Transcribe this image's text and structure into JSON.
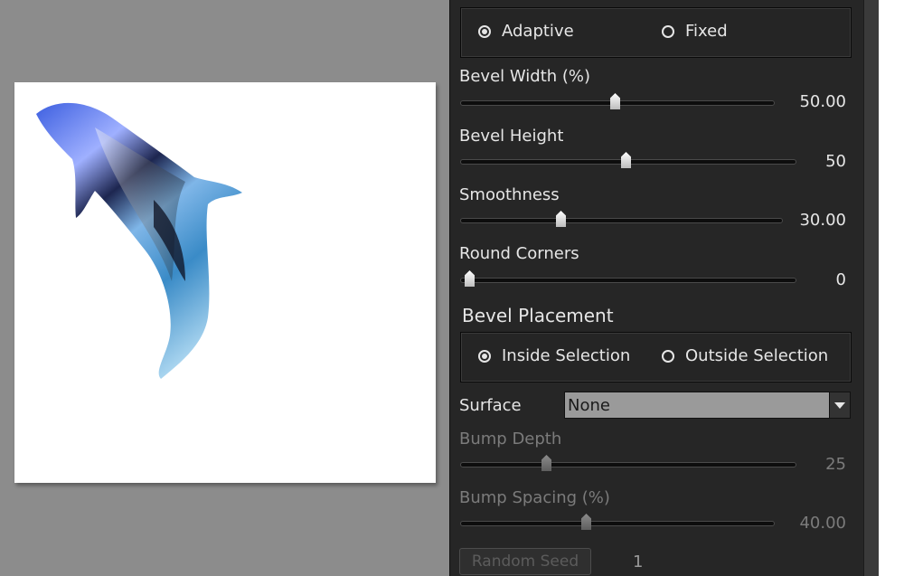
{
  "bevel_type": {
    "options": [
      {
        "label": "Adaptive",
        "selected": true
      },
      {
        "label": "Fixed",
        "selected": false
      }
    ]
  },
  "sliders": [
    {
      "label": "Bevel Width (%)",
      "value": "50.00",
      "fraction": 0.46,
      "enabled": true
    },
    {
      "label": "Bevel Height",
      "value": "50",
      "fraction": 0.5,
      "enabled": true
    },
    {
      "label": "Smoothness",
      "value": "30.00",
      "fraction": 0.31,
      "enabled": true
    },
    {
      "label": "Round Corners",
      "value": "0",
      "fraction": 0.0,
      "enabled": true
    }
  ],
  "bevel_placement": {
    "heading": "Bevel Placement",
    "options": [
      {
        "label": "Inside Selection",
        "selected": true
      },
      {
        "label": "Outside Selection",
        "selected": false
      }
    ]
  },
  "surface": {
    "label": "Surface",
    "value": "None"
  },
  "bump_sliders": [
    {
      "label": "Bump Depth",
      "value": "25",
      "fraction": 0.25,
      "enabled": false
    },
    {
      "label": "Bump Spacing (%)",
      "value": "40.00",
      "fraction": 0.4,
      "enabled": false
    }
  ],
  "random_seed": {
    "label": "Random Seed",
    "value": "1",
    "enabled": false
  },
  "colors": {
    "panel": "#262626",
    "canvas": "#8c8c8c",
    "text": "#e6e6e6",
    "disabled_text": "#7b7b7b"
  }
}
